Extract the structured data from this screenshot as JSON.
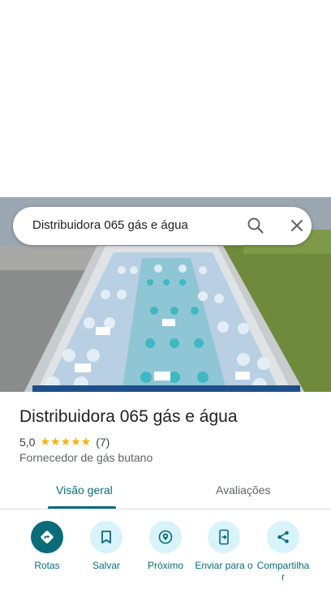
{
  "search": {
    "query": "Distribuidora 065 gás e água"
  },
  "place": {
    "title": "Distribuidora 065 gás e água",
    "rating": "5,0",
    "stars": "★★★★★",
    "review_count": "(7)",
    "category": "Fornecedor de gás butano"
  },
  "tabs": [
    {
      "label": "Visão geral"
    },
    {
      "label": "Avaliações"
    }
  ],
  "actions": [
    {
      "label": "Rotas",
      "icon": "directions-icon"
    },
    {
      "label": "Salvar",
      "icon": "bookmark-icon"
    },
    {
      "label": "Próximo",
      "icon": "nearby-icon"
    },
    {
      "label": "Enviar para o",
      "icon": "send-to-phone-icon"
    },
    {
      "label": "Compartilha r",
      "icon": "share-icon"
    }
  ],
  "colors": {
    "accent": "#0b6b79",
    "accent_light": "#d8f3fa",
    "star": "#f5b400"
  }
}
